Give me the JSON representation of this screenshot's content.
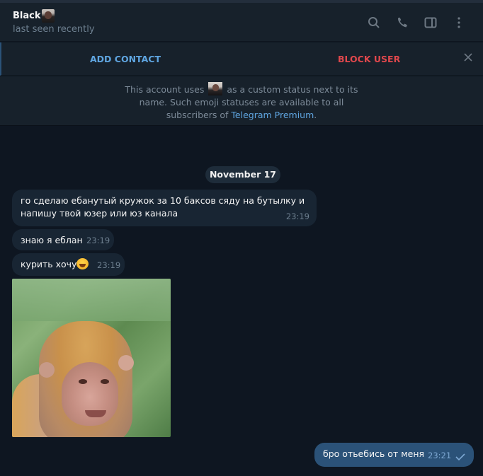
{
  "header": {
    "name": "Black",
    "emoji_status_icon": "custom-emoji-portrait",
    "status": "last seen recently",
    "icons": [
      "search-icon",
      "phone-icon",
      "sidebar-toggle-icon",
      "more-vertical-icon"
    ]
  },
  "action_bar": {
    "add_contact": "ADD CONTACT",
    "block_user": "BLOCK USER",
    "close_icon": "close-icon"
  },
  "info_banner": {
    "text_before": "This account uses",
    "text_after": "as a custom status next to its",
    "line2": "name. Such emoji statuses are available to all",
    "line3_prefix": "subscribers of ",
    "link": "Telegram Premium",
    "line3_suffix": "."
  },
  "chat": {
    "date_separator": "November 17",
    "messages": [
      {
        "direction": "incoming",
        "line1": "го сделаю ебанутый кружок за 10 баксов сяду на бутылку и",
        "line2": "напишу твой юзер или юз канала",
        "time": "23:19"
      },
      {
        "direction": "incoming",
        "text": "знаю я еблан",
        "time": "23:19"
      },
      {
        "direction": "incoming",
        "text": "курить хочу",
        "emoji": "laughing-tears",
        "time": "23:19"
      },
      {
        "direction": "incoming",
        "type": "media",
        "description": "smiling monkey video/GIF"
      },
      {
        "direction": "outgoing",
        "text": "бро отьебись от меня",
        "time": "23:21",
        "status": "sent-single-check"
      }
    ]
  },
  "colors": {
    "accent_blue": "#5fa5e0",
    "danger_red": "#e0474c",
    "outgoing_bubble": "#2b5278",
    "incoming_bubble": "#182533",
    "chat_background": "#0e1621",
    "header_background": "#17212b"
  }
}
